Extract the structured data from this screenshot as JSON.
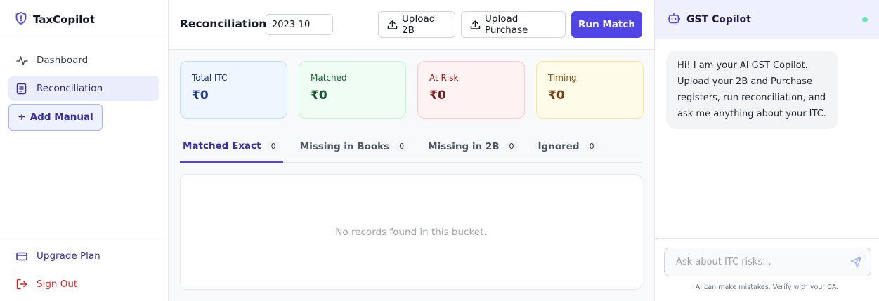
{
  "app": {
    "name": "TaxCopilot",
    "brand_color": "#4f46e5"
  },
  "sidebar": {
    "items": [
      {
        "label": "Dashboard",
        "icon": "activity-icon"
      },
      {
        "label": "Reconciliation",
        "icon": "document-icon",
        "active": true
      }
    ],
    "add_manual": {
      "plus": "+",
      "label": "Add Manual"
    },
    "bottom": [
      {
        "label": "Upgrade Plan",
        "icon": "credit-card-icon"
      },
      {
        "label": "Sign Out",
        "icon": "logout-icon"
      }
    ]
  },
  "header": {
    "title": "Reconciliation",
    "period_value": "2023-10",
    "upload_2b_label": "Upload 2B",
    "upload_purchase_label": "Upload Purchase",
    "run_match_label": "Run Match"
  },
  "cards": [
    {
      "label": "Total ITC",
      "value": "₹0"
    },
    {
      "label": "Matched",
      "value": "₹0"
    },
    {
      "label": "At Risk",
      "value": "₹0"
    },
    {
      "label": "Timing",
      "value": "₹0"
    }
  ],
  "tabs": [
    {
      "label": "Matched Exact",
      "count": "0",
      "active": true
    },
    {
      "label": "Missing in Books",
      "count": "0"
    },
    {
      "label": "Missing in 2B",
      "count": "0"
    },
    {
      "label": "Ignored",
      "count": "0"
    }
  ],
  "records": {
    "empty_text": "No records found in this bucket."
  },
  "copilot": {
    "title": "GST Copilot",
    "status_color": "#6ee7b7",
    "message": "Hi! I am your AI GST Copilot. Upload your 2B and Purchase registers, run reconciliation, and ask me anything about your ITC.",
    "input_placeholder": "Ask about ITC risks...",
    "disclaimer": "AI can make mistakes. Verify with your CA."
  }
}
